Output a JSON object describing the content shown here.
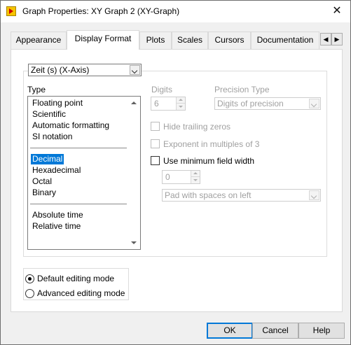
{
  "window": {
    "title": "Graph Properties: XY Graph 2 (XY-Graph)",
    "close_glyph": "✕",
    "app_icon": "labview-vi-icon"
  },
  "tabs": [
    {
      "label": "Appearance",
      "active": false
    },
    {
      "label": "Display Format",
      "active": true
    },
    {
      "label": "Plots",
      "active": false
    },
    {
      "label": "Scales",
      "active": false
    },
    {
      "label": "Cursors",
      "active": false
    },
    {
      "label": "Documentation",
      "active": false
    }
  ],
  "tab_scroll": {
    "left_glyph": "◀",
    "right_glyph": "▶"
  },
  "axis_select": {
    "value": "Zeit (s) (X-Axis)"
  },
  "type": {
    "label": "Type",
    "group1": [
      "Floating point",
      "Scientific",
      "Automatic formatting",
      "SI notation"
    ],
    "group2": [
      "Decimal",
      "Hexadecimal",
      "Octal",
      "Binary"
    ],
    "group3": [
      "Absolute time",
      "Relative time"
    ],
    "selected": "Decimal"
  },
  "digits": {
    "label": "Digits",
    "value": "6"
  },
  "precision": {
    "label": "Precision Type",
    "value": "Digits of precision"
  },
  "options": {
    "hide_trailing_zeros": "Hide trailing zeros",
    "exponent_multiples": "Exponent in multiples of 3",
    "use_min_width": "Use minimum field width"
  },
  "min_width": {
    "value": "0"
  },
  "pad": {
    "value": "Pad with spaces on left"
  },
  "editing_mode": {
    "default_label": "Default editing mode",
    "advanced_label": "Advanced editing mode",
    "selected": "default"
  },
  "buttons": {
    "ok": "OK",
    "cancel": "Cancel",
    "help": "Help"
  },
  "colors": {
    "selection": "#0078d7",
    "disabled_text": "#a0a0a0",
    "dialog_bg": "#f0f0f0"
  }
}
